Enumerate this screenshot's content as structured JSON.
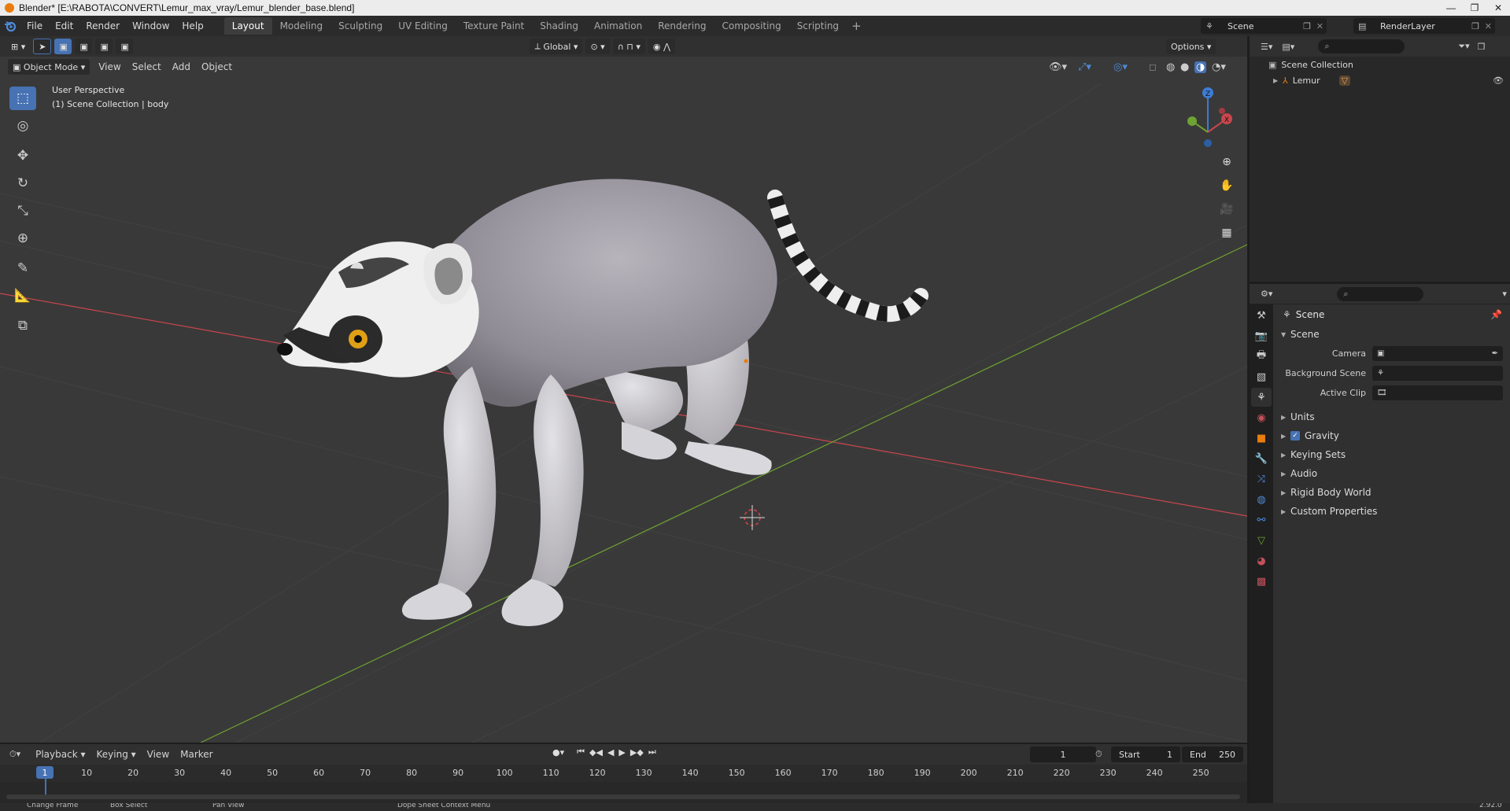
{
  "window": {
    "title": "Blender* [E:\\RABOTA\\CONVERT\\Lemur_max_vray/Lemur_blender_base.blend]",
    "controls": [
      "—",
      "❐",
      "✕"
    ]
  },
  "menu": [
    "File",
    "Edit",
    "Render",
    "Window",
    "Help"
  ],
  "workspaces": [
    "Layout",
    "Modeling",
    "Sculpting",
    "UV Editing",
    "Texture Paint",
    "Shading",
    "Animation",
    "Rendering",
    "Compositing",
    "Scripting"
  ],
  "active_workspace": "Layout",
  "scene_selector": "Scene",
  "render_layer": "RenderLayer",
  "viewport": {
    "mode": "Object Mode",
    "menus": [
      "View",
      "Select",
      "Add",
      "Object"
    ],
    "transform_orientation": "Global",
    "options_label": "Options",
    "perspective_label": "User Perspective",
    "collection_label": "(1) Scene Collection | body",
    "gizmo": {
      "x": "X",
      "y": "Y",
      "z": "Z"
    }
  },
  "outliner": {
    "root": "Scene Collection",
    "items": [
      {
        "label": "Lemur"
      }
    ]
  },
  "properties": {
    "title": "Scene",
    "panel": "Scene",
    "fields": [
      {
        "label": "Camera",
        "value": ""
      },
      {
        "label": "Background Scene",
        "value": ""
      },
      {
        "label": "Active Clip",
        "value": ""
      }
    ],
    "sections": [
      {
        "label": "Units"
      },
      {
        "label": "Gravity",
        "checked": true
      },
      {
        "label": "Keying Sets"
      },
      {
        "label": "Audio"
      },
      {
        "label": "Rigid Body World"
      },
      {
        "label": "Custom Properties"
      }
    ]
  },
  "timeline": {
    "menus": [
      "Playback",
      "Keying",
      "View",
      "Marker"
    ],
    "current_frame": "1",
    "start_label": "Start",
    "start": "1",
    "end_label": "End",
    "end": "250",
    "ticks": [
      "10",
      "20",
      "30",
      "40",
      "50",
      "60",
      "70",
      "80",
      "90",
      "100",
      "110",
      "120",
      "130",
      "140",
      "150",
      "160",
      "170",
      "180",
      "190",
      "200",
      "210",
      "220",
      "230",
      "240",
      "250"
    ],
    "frame_indicator": "1"
  },
  "status": {
    "items": [
      "Change Frame",
      "Box Select",
      "Pan View",
      "Dope Sheet Context Menu"
    ],
    "version": "2.92.0"
  },
  "colors": {
    "accent": "#4772b3",
    "x_axis": "#c9464d",
    "y_axis": "#6ea232",
    "z_axis": "#3d7cd6"
  }
}
